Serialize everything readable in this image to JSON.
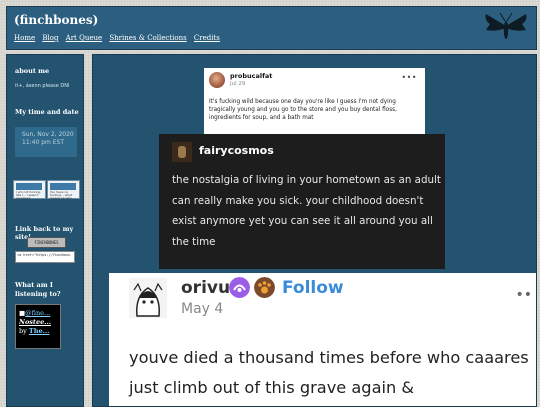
{
  "header": {
    "title": "(finchbones)",
    "nav": [
      "Home",
      "Blog",
      "Art Queue",
      "Shrines & Collections",
      "Credits"
    ]
  },
  "sidebar": {
    "about_heading": "about me",
    "about_text": "it+, ásenn please DNI",
    "time_heading": "My time and date",
    "clock_line1": "Sun, Nov 2, 2020",
    "clock_line2": "11:40 pm EST",
    "tile1_text": "I am not fucking like I... I wasn't equipped",
    "tile2_text": "You have no fucking... what means up why",
    "link_heading": "Link back to my site!",
    "badge_text": "FINCHBONES",
    "code_text": "<a href=\"https://finchbon.",
    "listen_heading": "What am I listening to?",
    "listen_line1": "@fine...",
    "listen_line2": "Nostee...",
    "listen_by": "by",
    "listen_line3": "The..."
  },
  "posts": {
    "post1": {
      "username": "probucalfat",
      "date": "Jul 29",
      "body": "It's fucking wild because one day you're like I guess I'm not dying tragically young and you go to the store and you buy dental floss, ingredients for soup, and a bath mat"
    },
    "post2": {
      "username": "fairycosmos",
      "body": "the nostalgia of living in your hometown as an adult can really make you sick. your childhood doesn't exist anymore yet you can see it all around you all the time"
    },
    "post3": {
      "username": "orivu",
      "follow": "Follow",
      "date": "May 4",
      "body": "youve died a thousand times before who caaares just climb out of this grave again &"
    }
  },
  "colors": {
    "panel": "#23536f",
    "header": "#2c5f7f",
    "follow": "#3b8bd8"
  }
}
